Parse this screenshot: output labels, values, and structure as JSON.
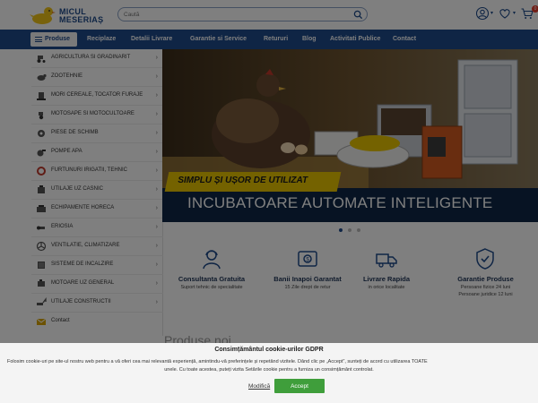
{
  "header": {
    "logo_line1": "MICUL",
    "logo_line2": "MESERIAȘ",
    "search_placeholder": "Caută",
    "cart_count": "0"
  },
  "nav": {
    "products_label": "Produse",
    "links": [
      "Reciplaze",
      "Detalii Livrare",
      "Garantie si Service",
      "Retururi",
      "Blog",
      "Activitati Publice",
      "Contact"
    ]
  },
  "sidebar": {
    "categories": [
      {
        "label": "AGRICULTURA SI GRADINARIT",
        "icon": "tractor-icon"
      },
      {
        "label": "ZOOTEHNIE",
        "icon": "cow-icon"
      },
      {
        "label": "MORI CEREALE, TOCATOR FURAJE",
        "icon": "mill-icon"
      },
      {
        "label": "MOTOSAPE SI MOTOCULTOARE",
        "icon": "cultivator-icon"
      },
      {
        "label": "PIESE DE SCHIMB",
        "icon": "gear-icon"
      },
      {
        "label": "POMPE APA",
        "icon": "pump-icon"
      },
      {
        "label": "FURTUNURI IRIGATII, TEHNIC",
        "icon": "hose-icon"
      },
      {
        "label": "UTILAJE UZ CASNIC",
        "icon": "appliance-icon"
      },
      {
        "label": "ECHIPAMENTE HORECA",
        "icon": "horeca-icon"
      },
      {
        "label": "ERIOSIA",
        "icon": "tool-icon"
      },
      {
        "label": "VENTILATIE, CLIMATIZARE",
        "icon": "fan-icon"
      },
      {
        "label": "SISTEME DE INCALZIRE",
        "icon": "heater-icon"
      },
      {
        "label": "MOTOARE UZ GENERAL",
        "icon": "engine-icon"
      },
      {
        "label": "UTILAJE CONSTRUCTII",
        "icon": "excavator-icon"
      },
      {
        "label": "Contact",
        "icon": "contact-icon"
      }
    ]
  },
  "hero": {
    "slogan": "SIMPLU ȘI UȘOR DE UTILIZAT",
    "title": "INCUBATOARE AUTOMATE INTELIGENTE"
  },
  "features": [
    {
      "title": "Consultanta Gratuita",
      "sub": "Suport tehnic de specialitate",
      "sub2": "",
      "icon": "consultant-icon"
    },
    {
      "title": "Banii Inapoi Garantat",
      "sub": "15 Zile drept de retur",
      "sub2": "",
      "icon": "money-back-icon"
    },
    {
      "title": "Livrare Rapida",
      "sub": "in orice localitate",
      "sub2": "",
      "icon": "truck-icon"
    },
    {
      "title": "Garantie Produse",
      "sub": "Persoane fizice 24 luni",
      "sub2": "Persoane juridice 12 luni",
      "icon": "shield-check-icon"
    }
  ],
  "section_title": "Produse noi",
  "cookie": {
    "title": "Consimțământul cookie-urilor GDPR",
    "text1": "Folosim cookie-uri pe site-ul nostru web pentru a vă oferi cea mai relevantă experiență, amintindu-vă preferințele și repetând vizitele. Dând clic pe „Accept”, sunteți de acord cu utilizarea TOATE",
    "text2": "unele. Cu toate acestea, puteți vizita Setările cookie pentru a furniza un consimțământ controlat.",
    "modify_label": "Modifică",
    "accept_label": "Accept"
  },
  "colors": {
    "brand_blue": "#1e4a8a",
    "accept_green": "#3f9e3b",
    "slogan_yellow": "#e8c400",
    "badge_red": "#e23a2a"
  }
}
